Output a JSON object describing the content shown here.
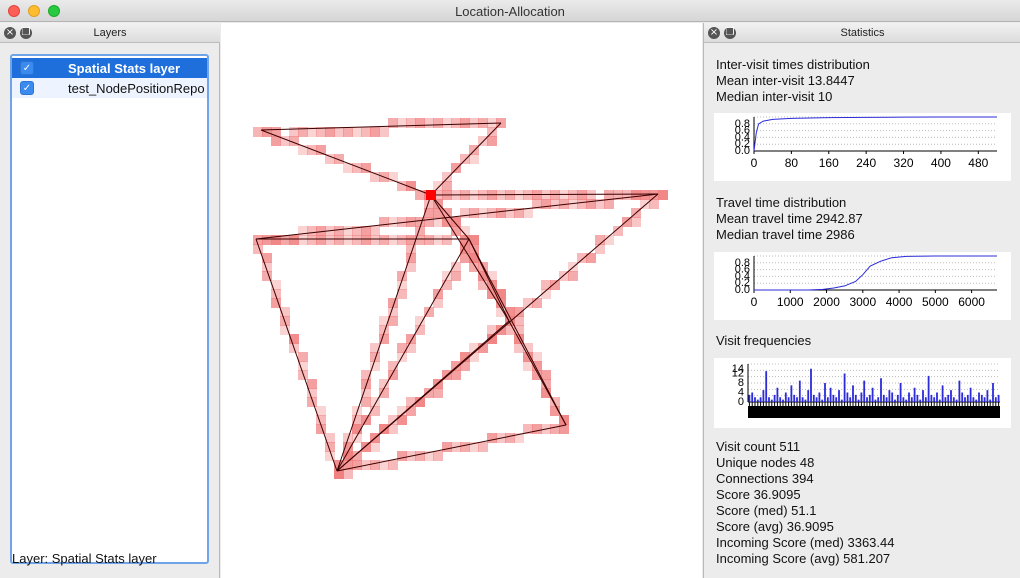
{
  "window": {
    "title": "Location-Allocation"
  },
  "layers_panel": {
    "title": "Layers",
    "close_icon": "close-icon",
    "float_icon": "float-icon",
    "items": [
      {
        "label": "Spatial Stats layer",
        "checked": true,
        "selected": true
      },
      {
        "label": "test_NodePositionRepo",
        "checked": true,
        "selected": false
      }
    ],
    "status": "Layer: Spatial Stats layer"
  },
  "stats_panel": {
    "title": "Statistics",
    "inter_visit": {
      "heading": "Inter-visit times distribution",
      "mean": "Mean inter-visit 13.8447",
      "median": "Median inter-visit 10"
    },
    "travel": {
      "heading": "Travel time distribution",
      "mean": "Mean travel time 2942.87",
      "median": "Median travel time 2986"
    },
    "visit_freq": {
      "heading": "Visit frequencies"
    },
    "summary": [
      "Visit count 511",
      "Unique nodes 48",
      "Connections 394",
      "Score 36.9095",
      "Score (med) 51.1",
      "Score (avg) 36.9095",
      "Incoming Score (med) 3363.44",
      "Incoming Score (avg) 581.207"
    ]
  },
  "colors": {
    "accent": "#1e6fdc",
    "series": "#2b2bd9",
    "network": "#f08080",
    "hub": "#ff0000"
  },
  "chart_data": [
    {
      "type": "line",
      "name": "inter-visit-cdf",
      "x_ticks": [
        "0",
        "80",
        "160",
        "240",
        "320",
        "400",
        "480"
      ],
      "y_ticks": [
        "0.0",
        "0.2",
        "0.4",
        "0.6",
        "0.8"
      ],
      "xlim": [
        0,
        520
      ],
      "ylim": [
        0,
        1
      ],
      "x": [
        0,
        5,
        10,
        20,
        40,
        80,
        160,
        240,
        320,
        400,
        480,
        520
      ],
      "y": [
        0.0,
        0.55,
        0.8,
        0.88,
        0.93,
        0.96,
        0.98,
        0.99,
        0.995,
        1.0,
        1.0,
        1.0
      ]
    },
    {
      "type": "line",
      "name": "travel-time-cdf",
      "x_ticks": [
        "0",
        "1000",
        "2000",
        "3000",
        "4000",
        "5000",
        "6000"
      ],
      "y_ticks": [
        "0.0",
        "0.2",
        "0.4",
        "0.6",
        "0.8"
      ],
      "xlim": [
        0,
        6700
      ],
      "ylim": [
        0,
        1
      ],
      "x": [
        0,
        1500,
        1900,
        2200,
        2500,
        2800,
        3000,
        3200,
        3500,
        3800,
        4200,
        5000,
        6700
      ],
      "y": [
        0.0,
        0.0,
        0.02,
        0.06,
        0.12,
        0.25,
        0.45,
        0.7,
        0.85,
        0.95,
        0.99,
        1.0,
        1.0
      ]
    },
    {
      "type": "bar",
      "name": "visit-frequencies",
      "y_ticks": [
        "0",
        "4",
        "8",
        "12",
        "14"
      ],
      "ylim": [
        0,
        16
      ],
      "values": [
        3,
        4,
        2,
        1,
        2,
        5,
        13,
        2,
        1,
        3,
        6,
        2,
        1,
        4,
        2,
        7,
        3,
        2,
        9,
        2,
        1,
        5,
        14,
        3,
        2,
        4,
        1,
        8,
        2,
        6,
        3,
        2,
        5,
        1,
        12,
        4,
        2,
        7,
        3,
        1,
        4,
        9,
        2,
        3,
        6,
        1,
        2,
        10,
        3,
        2,
        5,
        4,
        1,
        3,
        8,
        2,
        1,
        4,
        2,
        6,
        3,
        1,
        5,
        2,
        11,
        3,
        2,
        4,
        1,
        7,
        2,
        3,
        5,
        2,
        1,
        9,
        4,
        2,
        3,
        6,
        2,
        1,
        4,
        3,
        2,
        5,
        1,
        8,
        2,
        3
      ]
    }
  ]
}
